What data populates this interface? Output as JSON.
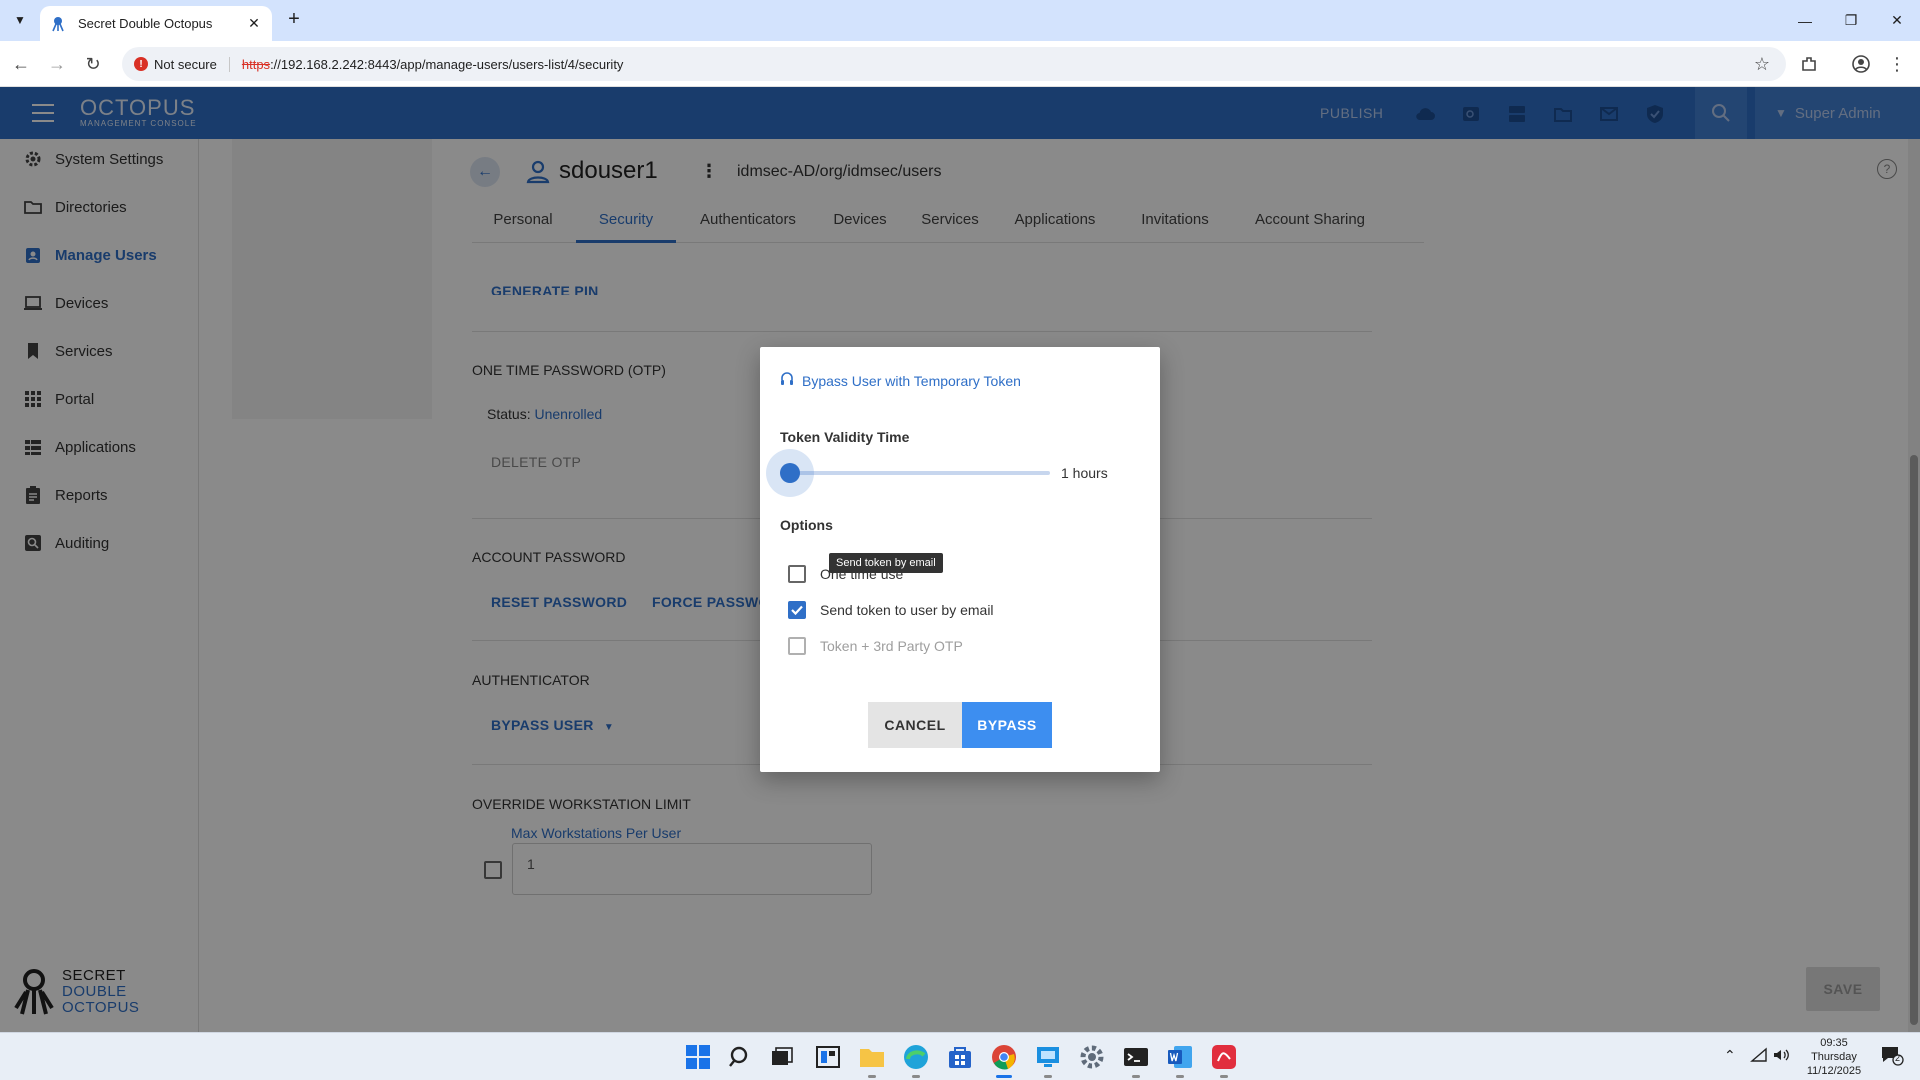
{
  "browser": {
    "tab_title": "Secret Double Octopus",
    "not_secure": "Not secure",
    "url_scheme": "https",
    "url_rest": "://192.168.2.242:8443/app/manage-users/users-list/4/security"
  },
  "header": {
    "logo_name": "OCTOPUS",
    "logo_sub": "MANAGEMENT CONSOLE",
    "publish": "PUBLISH",
    "user": "Super Admin"
  },
  "sidebar": {
    "items": [
      {
        "label": "System Settings",
        "icon": "gear-icon"
      },
      {
        "label": "Directories",
        "icon": "folder-icon"
      },
      {
        "label": "Manage Users",
        "icon": "user-badge-icon"
      },
      {
        "label": "Devices",
        "icon": "laptop-icon"
      },
      {
        "label": "Services",
        "icon": "bookmark-icon"
      },
      {
        "label": "Portal",
        "icon": "grid-icon"
      },
      {
        "label": "Applications",
        "icon": "apps-icon"
      },
      {
        "label": "Reports",
        "icon": "clipboard-icon"
      },
      {
        "label": "Auditing",
        "icon": "search-box-icon"
      }
    ],
    "brand": [
      "SECRET",
      "DOUBLE",
      "OCTOPUS"
    ]
  },
  "user_page": {
    "username": "sdouser1",
    "path": "idmsec-AD/org/idmsec/users",
    "tabs": [
      "Personal",
      "Security",
      "Authenticators",
      "Devices",
      "Services",
      "Applications",
      "Invitations",
      "Account Sharing"
    ],
    "active_tab": "Security",
    "generate_pin": "GENERATE PIN",
    "otp_title": "ONE TIME PASSWORD (OTP)",
    "status_label": "Status:",
    "status_value": "Unenrolled",
    "delete_otp": "DELETE OTP",
    "account_password_title": "ACCOUNT PASSWORD",
    "reset_password": "RESET PASSWORD",
    "force_password": "FORCE PASSWORD",
    "authenticator_title": "AUTHENTICATOR",
    "bypass_user": "BYPASS USER",
    "override_title": "OVERRIDE WORKSTATION LIMIT",
    "max_ws_label": "Max Workstations Per User",
    "max_ws_value": "1",
    "save": "SAVE"
  },
  "dialog": {
    "title": "Bypass User with Temporary Token",
    "validity_label": "Token Validity Time",
    "validity_value": "1 hours",
    "slider_fraction": 0,
    "options_label": "Options",
    "options": [
      {
        "label": "One time use",
        "checked": false,
        "disabled": false
      },
      {
        "label": "Send token to user by email",
        "checked": true,
        "disabled": false
      },
      {
        "label": "Token + 3rd Party OTP",
        "checked": false,
        "disabled": true
      }
    ],
    "tooltip": "Send token by email",
    "cancel": "CANCEL",
    "bypass": "BYPASS"
  },
  "taskbar": {
    "time": "09:35",
    "day": "Thursday",
    "date": "11/12/2025",
    "notifications": "2"
  },
  "colors": {
    "brand_blue": "#2f6fc7",
    "primary_button": "#3d8ef0",
    "warning_red": "#d93025"
  }
}
